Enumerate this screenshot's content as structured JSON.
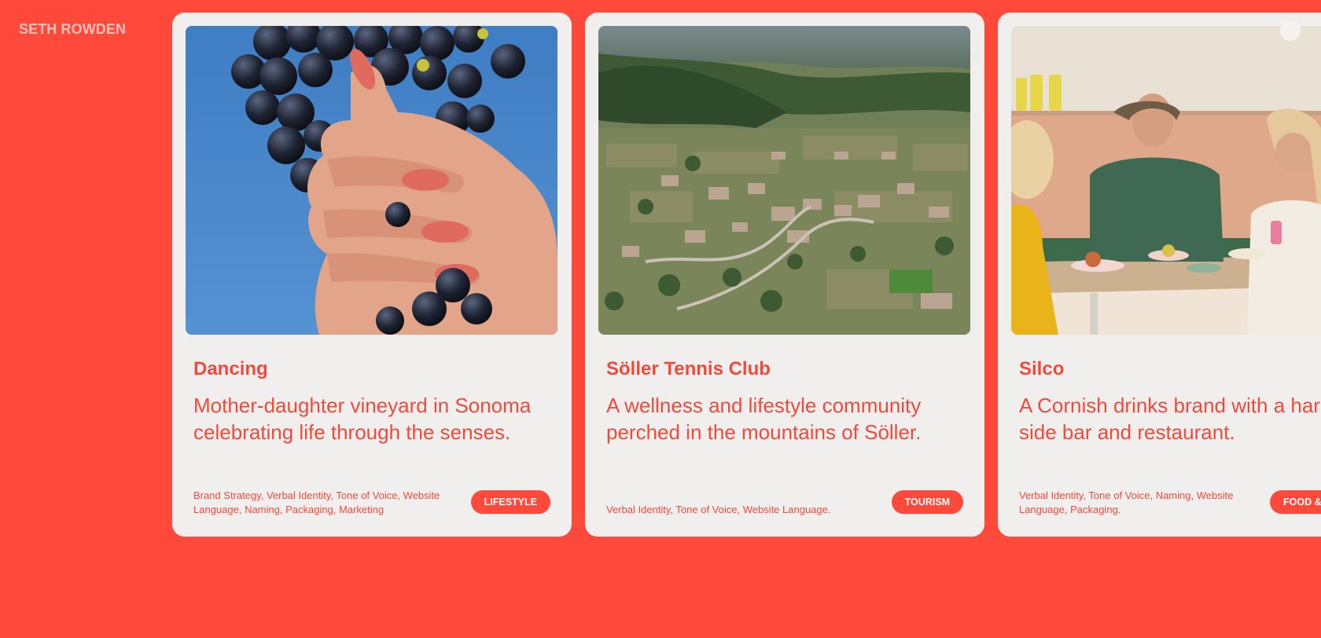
{
  "brand": {
    "name": "SETH ROWDEN"
  },
  "projects": [
    {
      "title": "Dancing",
      "description": "Mother-daughter vineyard in Sonoma celebrating life through the senses.",
      "services": "Brand Strategy, Verbal Identity, Tone of Voice, Website Language, Naming, Packaging, Marketing",
      "category": "LIFESTYLE",
      "image": "hand-squeezing-grapes"
    },
    {
      "title": "Söller Tennis Club",
      "description": "A wellness and lifestyle community perched in the mountains of Söller.",
      "services": "Verbal Identity, Tone of Voice, Website Language.",
      "category": "TOURISM",
      "image": "aerial-valley-town"
    },
    {
      "title": "Silco",
      "description": "A Cornish drinks brand with a harbour-side bar and restaurant.",
      "services": "Verbal Identity, Tone of Voice, Naming, Website Language, Packaging.",
      "category": "FOOD &",
      "image": "friends-dining-table"
    }
  ],
  "colors": {
    "background": "#ff4a3b",
    "card": "#f0efed",
    "accent_text": "#f04a3c",
    "logo": "#ffc0b8"
  }
}
